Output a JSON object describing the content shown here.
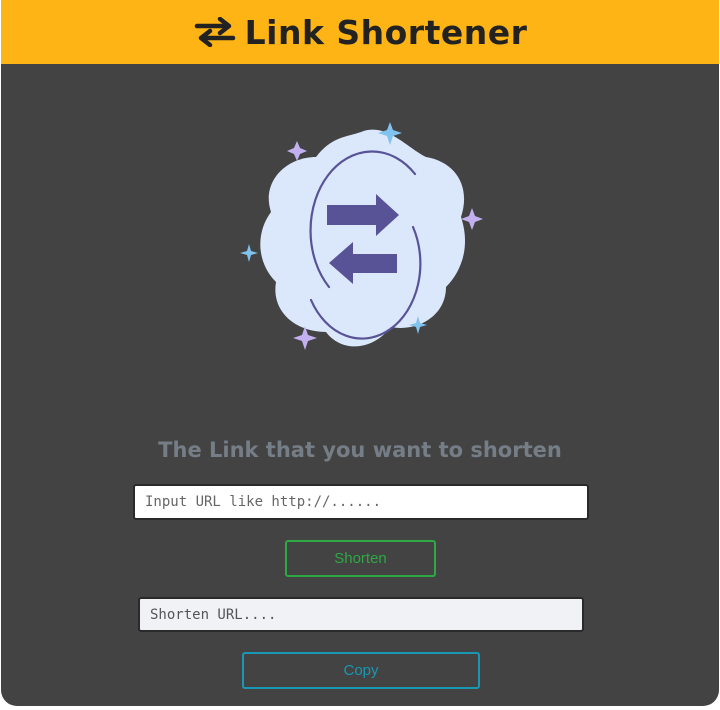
{
  "header": {
    "title": "Link Shortener",
    "icon": "swap-arrows-icon",
    "bg_color": "#fdb414"
  },
  "illustration": {
    "icon": "swap-arrows-illustration",
    "blob_color": "#dbe7fb",
    "arrow_color": "#585397",
    "sparkle_colors": [
      "#c3b0f0",
      "#7fc3ee"
    ]
  },
  "form": {
    "caption": "The Link that you want to shorten",
    "url_input": {
      "value": "",
      "placeholder": "Input URL like http://......"
    },
    "shorten_label": "Shorten",
    "output_input": {
      "value": "",
      "placeholder": "Shorten URL...."
    },
    "copy_label": "Copy"
  },
  "colors": {
    "panel": "#434343",
    "shorten_accent": "#2ea844",
    "copy_accent": "#1898b2",
    "caption_text": "#757d86"
  }
}
